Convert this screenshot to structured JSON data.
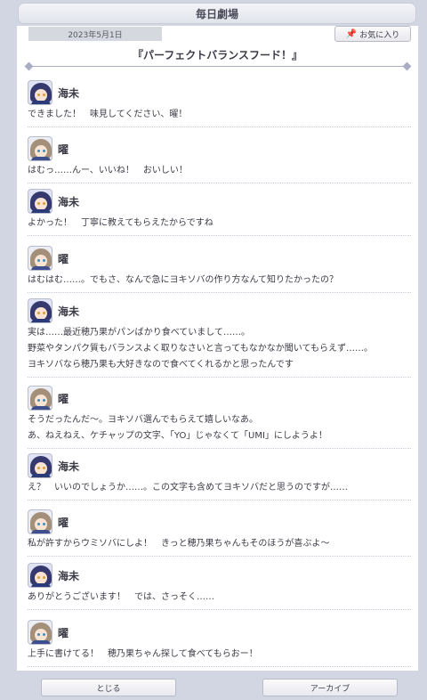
{
  "header": {
    "title": "毎日劇場",
    "date": "2023年5月1日",
    "favorite_label": "お気に入り",
    "story_title": "『パーフェクトバランスフード！』"
  },
  "entries": [
    {
      "speaker": "海未",
      "character": "umi",
      "lines": [
        "できました！　味見してください、曜！"
      ]
    },
    {
      "speaker": "曜",
      "character": "you",
      "lines": [
        "はむっ……んー、いいね！　おいしい！"
      ]
    },
    {
      "speaker": "海未",
      "character": "umi",
      "lines": [
        "よかった！　丁寧に教えてもらえたからですね"
      ]
    },
    {
      "speaker": "曜",
      "character": "you",
      "lines": [
        "はむはむ……。でもさ、なんで急にヨキソバの作り方なんて知りたかったの？"
      ]
    },
    {
      "speaker": "海未",
      "character": "umi",
      "lines": [
        "実は……最近穂乃果がパンばかり食べていまして……。",
        "野菜やタンパク質もバランスよく取りなさいと言ってもなかなか聞いてもらえず……。",
        "ヨキソバなら穂乃果も大好きなので食べてくれるかと思ったんです"
      ]
    },
    {
      "speaker": "曜",
      "character": "you",
      "lines": [
        "そうだったんだ〜。ヨキソバ選んでもらえて嬉しいなあ。",
        "あ、ねえねえ、ケチャップの文字、「YO」じゃなくて「UMI」にしようよ！"
      ]
    },
    {
      "speaker": "海未",
      "character": "umi",
      "lines": [
        "え？　いいのでしょうか……。この文字も含めてヨキソバだと思うのですが……"
      ]
    },
    {
      "speaker": "曜",
      "character": "you",
      "lines": [
        "私が許すからウミソバにしよ！　きっと穂乃果ちゃんもそのほうが喜ぶよ〜"
      ]
    },
    {
      "speaker": "海未",
      "character": "umi",
      "lines": [
        "ありがとうございます！　では、さっそく……"
      ]
    },
    {
      "speaker": "曜",
      "character": "you",
      "lines": [
        "上手に書けてる！　穂乃果ちゃん探して食べてもらおー！"
      ]
    }
  ],
  "footer": {
    "close_label": "とじる",
    "archive_label": "アーカイブ"
  }
}
